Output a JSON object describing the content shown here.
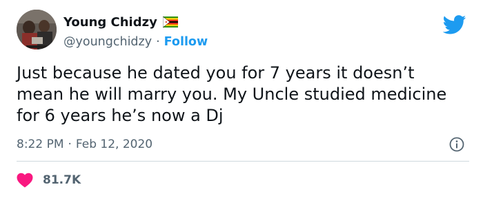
{
  "author": {
    "name": "Young Chidzy",
    "handle": "@youngchidzy",
    "follow_label": "Follow",
    "separator": "·"
  },
  "tweet": {
    "text": "Just because he dated you for 7 years it doesn’t mean he will marry you. My Uncle studied medicine for 6 years he’s now a Dj",
    "time": "8:22 PM",
    "date": "Feb 12, 2020",
    "separator": "·"
  },
  "engagement": {
    "likes": "81.7K"
  },
  "icons": {
    "platform": "twitter-bird-icon",
    "flag": "zimbabwe-flag-icon",
    "info": "info-icon",
    "like": "heart-icon"
  },
  "colors": {
    "accent": "#1d9bf0",
    "like": "#f91880",
    "text": "#0f1419",
    "secondary": "#536471"
  }
}
